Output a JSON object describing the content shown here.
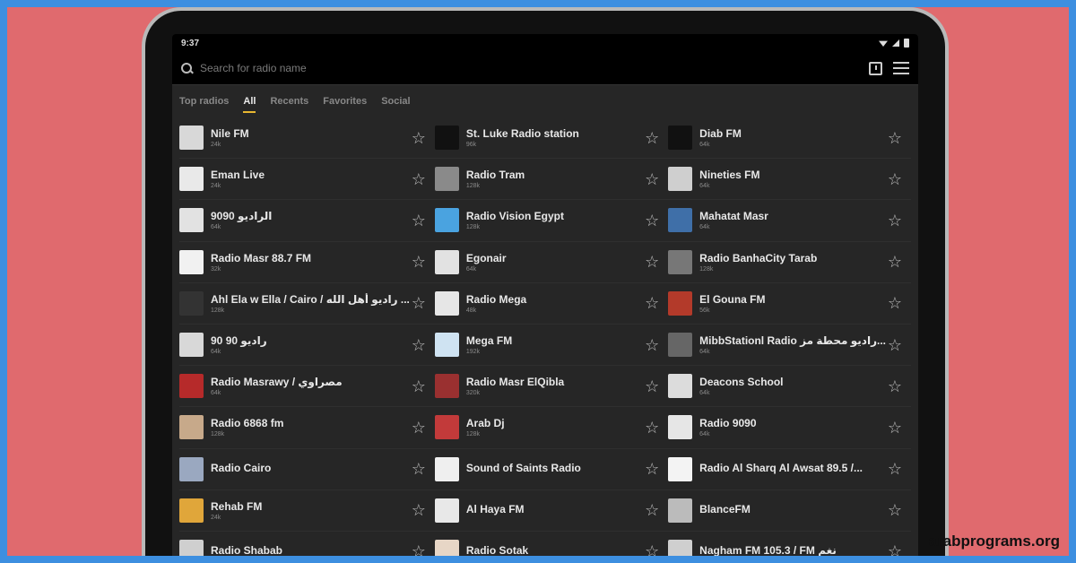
{
  "status": {
    "time": "9:37"
  },
  "search": {
    "placeholder": "Search for radio name"
  },
  "tabs": [
    {
      "label": "Top radios",
      "active": false
    },
    {
      "label": "All",
      "active": true
    },
    {
      "label": "Recents",
      "active": false
    },
    {
      "label": "Favorites",
      "active": false
    },
    {
      "label": "Social",
      "active": false
    }
  ],
  "colors": {
    "accent": "#e8b730",
    "background": "#262626",
    "page_bg": "#e06a6e"
  },
  "stations": [
    {
      "name": "Nile FM",
      "bitrate": "24k",
      "logo": "#d8d8d8"
    },
    {
      "name": "St. Luke Radio station",
      "bitrate": "96k",
      "logo": "#111111"
    },
    {
      "name": "Diab FM",
      "bitrate": "64k",
      "logo": "#111111"
    },
    {
      "name": "Eman Live",
      "bitrate": "24k",
      "logo": "#e9e9e9"
    },
    {
      "name": "Radio Tram",
      "bitrate": "128k",
      "logo": "#8a8a8a"
    },
    {
      "name": "Nineties FM",
      "bitrate": "64k",
      "logo": "#cfcfcf"
    },
    {
      "name": "الراديو 9090",
      "bitrate": "64k",
      "logo": "#e2e2e2"
    },
    {
      "name": "Radio Vision Egypt",
      "bitrate": "128k",
      "logo": "#4aa3e0"
    },
    {
      "name": "Mahatat Masr",
      "bitrate": "64k",
      "logo": "#3f6fa8"
    },
    {
      "name": "Radio Masr 88.7 FM",
      "bitrate": "32k",
      "logo": "#f1f1f1"
    },
    {
      "name": "Egonair",
      "bitrate": "64k",
      "logo": "#e2e2e2"
    },
    {
      "name": "Radio BanhaCity Tarab",
      "bitrate": "128k",
      "logo": "#777777"
    },
    {
      "name": "Ahl Ela w Ella / Cairo / راديو أهل الله ...",
      "bitrate": "128k",
      "logo": "#333333"
    },
    {
      "name": "Radio Mega",
      "bitrate": "48k",
      "logo": "#e6e6e6"
    },
    {
      "name": "El Gouna FM",
      "bitrate": "56k",
      "logo": "#b33a2a"
    },
    {
      "name": "راديو 90 90",
      "bitrate": "64k",
      "logo": "#d8d8d8"
    },
    {
      "name": "Mega FM",
      "bitrate": "192k",
      "logo": "#cfe3f2"
    },
    {
      "name": "MibbStationl Radio راديو محطة مز...",
      "bitrate": "64k",
      "logo": "#666666"
    },
    {
      "name": "Radio Masrawy / مصراوي",
      "bitrate": "64k",
      "logo": "#b62a2a"
    },
    {
      "name": "Radio Masr ElQibla",
      "bitrate": "320k",
      "logo": "#9a3030"
    },
    {
      "name": "Deacons School",
      "bitrate": "64k",
      "logo": "#dcdcdc"
    },
    {
      "name": "Radio 6868 fm",
      "bitrate": "128k",
      "logo": "#c7a98a"
    },
    {
      "name": "Arab Dj",
      "bitrate": "128k",
      "logo": "#c23a3a"
    },
    {
      "name": "Radio 9090",
      "bitrate": "64k",
      "logo": "#e6e6e6"
    },
    {
      "name": "Radio Cairo",
      "bitrate": "",
      "logo": "#9aa8c0"
    },
    {
      "name": "Sound of Saints Radio",
      "bitrate": "",
      "logo": "#efefef"
    },
    {
      "name": "Radio Al Sharq Al Awsat 89.5 /...",
      "bitrate": "",
      "logo": "#f3f3f3"
    },
    {
      "name": "Rehab FM",
      "bitrate": "24k",
      "logo": "#e0a63a"
    },
    {
      "name": "Al Haya FM",
      "bitrate": "",
      "logo": "#e8e8e8"
    },
    {
      "name": "BlanceFM",
      "bitrate": "",
      "logo": "#bbbbbb"
    },
    {
      "name": "Radio Shabab",
      "bitrate": "",
      "logo": "#cfcfcf"
    },
    {
      "name": "Radio Sotak",
      "bitrate": "",
      "logo": "#e7d6c6"
    },
    {
      "name": "Nagham FM 105.3 / FM نغم",
      "bitrate": "",
      "logo": "#cfcfcf"
    }
  ],
  "watermark": "arabprograms.org"
}
